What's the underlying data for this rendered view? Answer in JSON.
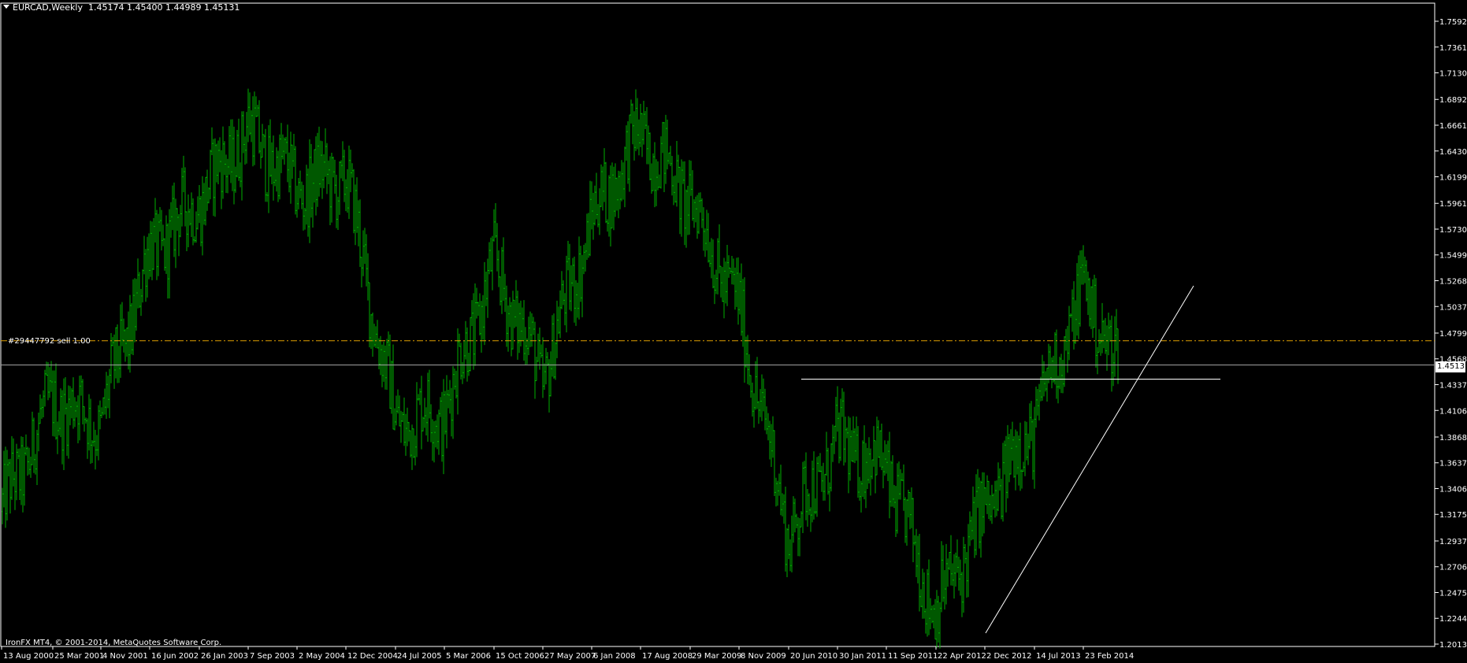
{
  "header": {
    "symbol": "EURCAD,Weekly",
    "ohlc": "1.45174 1.45400 1.44989 1.45131"
  },
  "copyright": "IronFX MT4, © 2001-2014, MetaQuotes Software Corp.",
  "order_label": "#29447792 sell 1.00",
  "current_price_label": "1.45131",
  "colors": {
    "background": "#000000",
    "bars": "#00b000",
    "axis": "#ffffff",
    "order_line": "#e0a000",
    "trend_lines": "#ffffff",
    "price_line": "#a0a0a0"
  },
  "chart_data": {
    "type": "bar",
    "style": "OHLC bars",
    "symbol": "EURCAD",
    "timeframe": "Weekly",
    "y_ticks": [
      "1.75920",
      "1.73610",
      "1.71300",
      "1.68920",
      "1.66610",
      "1.64300",
      "1.61990",
      "1.59610",
      "1.57300",
      "1.54990",
      "1.52680",
      "1.50370",
      "1.47990",
      "1.45680",
      "1.43370",
      "1.41060",
      "1.38680",
      "1.36370",
      "1.34060",
      "1.31750",
      "1.29370",
      "1.27060",
      "1.24750",
      "1.22440",
      "1.20130"
    ],
    "ylim": [
      1.2013,
      1.7708
    ],
    "x_ticks": [
      "13 Aug 2000",
      "25 Mar 2001",
      "4 Nov 2001",
      "16 Jun 2002",
      "26 Jan 2003",
      "7 Sep 2003",
      "2 May 2004",
      "12 Dec 2004",
      "24 Jul 2005",
      "5 Mar 2006",
      "15 Oct 2006",
      "27 May 2007",
      "6 Jan 2008",
      "17 Aug 2008",
      "29 Mar 2009",
      "8 Nov 2009",
      "20 Jun 2010",
      "30 Jan 2011",
      "11 Sep 2011",
      "22 Apr 2012",
      "2 Dec 2012",
      "14 Jul 2013",
      "23 Feb 2014"
    ],
    "price_path": [
      [
        "13 Aug 2000",
        1.32
      ],
      [
        "25 Mar 2001",
        1.42
      ],
      [
        "4 Nov 2001",
        1.4
      ],
      [
        "16 Jun 2002",
        1.55
      ],
      [
        "26 Jan 2003",
        1.6
      ],
      [
        "7 Sep 2003",
        1.66
      ],
      [
        "2 May 2004",
        1.61
      ],
      [
        "12 Dec 2004",
        1.62
      ],
      [
        "24 Jul 2005",
        1.4
      ],
      [
        "5 Mar 2006",
        1.41
      ],
      [
        "15 Oct 2006",
        1.54
      ],
      [
        "27 May 2007",
        1.44
      ],
      [
        "6 Jan 2008",
        1.58
      ],
      [
        "17 Aug 2008",
        1.66
      ],
      [
        "29 Mar 2009",
        1.6
      ],
      [
        "8 Nov 2009",
        1.5
      ],
      [
        "20 Jun 2010",
        1.3
      ],
      [
        "30 Jan 2011",
        1.38
      ],
      [
        "11 Sep 2011",
        1.36
      ],
      [
        "22 Apr 2012",
        1.23
      ],
      [
        "2 Dec 2012",
        1.32
      ],
      [
        "14 Jul 2013",
        1.4
      ],
      [
        "23 Feb 2014",
        1.52
      ],
      [
        "current",
        1.4513
      ]
    ],
    "current_price": 1.45131,
    "order_line_price": 1.473,
    "support_line_price": 1.4386
  }
}
